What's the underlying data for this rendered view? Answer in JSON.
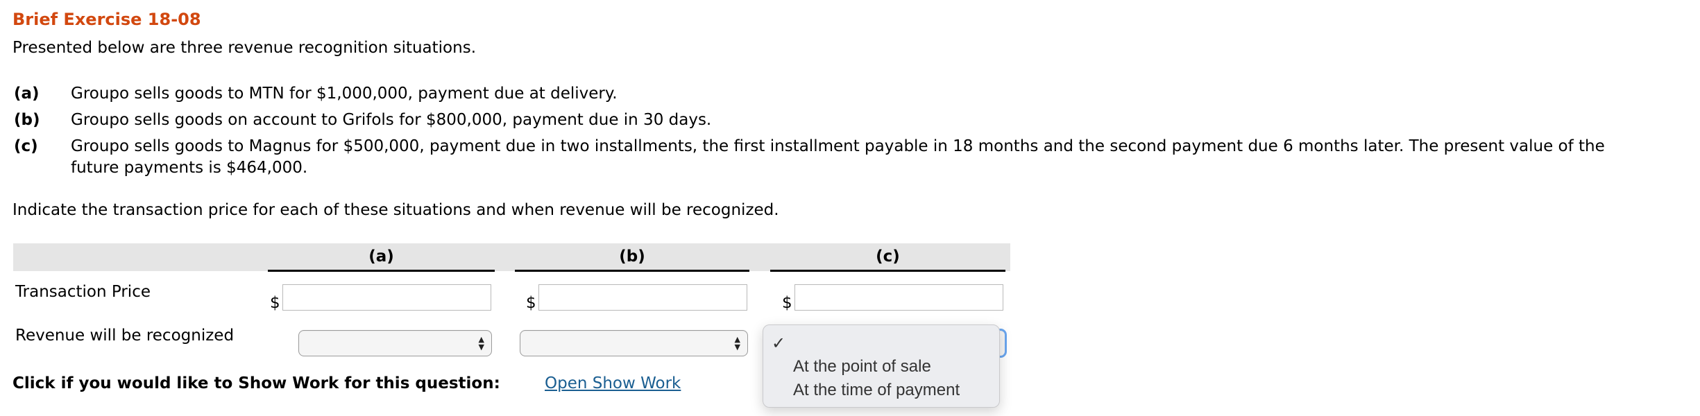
{
  "title": "Brief Exercise 18-08",
  "intro": "Presented below are three revenue recognition situations.",
  "situations": [
    {
      "label": "(a)",
      "lines": [
        "Groupo sells goods to MTN for $1,000,000, payment due at delivery."
      ]
    },
    {
      "label": "(b)",
      "lines": [
        "Groupo sells goods on account to Grifols for $800,000, payment due in 30 days."
      ]
    },
    {
      "label": "(c)",
      "lines": [
        "Groupo sells goods to Magnus for $500,000, payment due in two installments, the first installment payable in 18 months and the second payment due 6 months later. The present value of the",
        "future payments is $464,000."
      ]
    }
  ],
  "instruction": "Indicate the transaction price for each of these situations and when revenue will be recognized.",
  "table": {
    "columns": [
      "(a)",
      "(b)",
      "(c)"
    ],
    "rows": {
      "transaction_price": {
        "label": "Transaction Price",
        "currency": "$",
        "values": [
          "",
          "",
          ""
        ]
      },
      "revenue_recognized": {
        "label": "Revenue will be recognized",
        "values": [
          "",
          "",
          ""
        ]
      }
    }
  },
  "dropdown": {
    "open_for_column": "(c)",
    "check_glyph": "✓",
    "arrows_glyph": "▲▼",
    "options": [
      "",
      "At the point of sale",
      "At the time of payment"
    ],
    "selected_index": 0
  },
  "show_work": {
    "prompt": "Click if you would like to Show Work for this question:",
    "link": "Open Show Work"
  },
  "colors": {
    "title": "#d2480f",
    "link": "#1a5e91",
    "focus": "#6aa6ef"
  }
}
